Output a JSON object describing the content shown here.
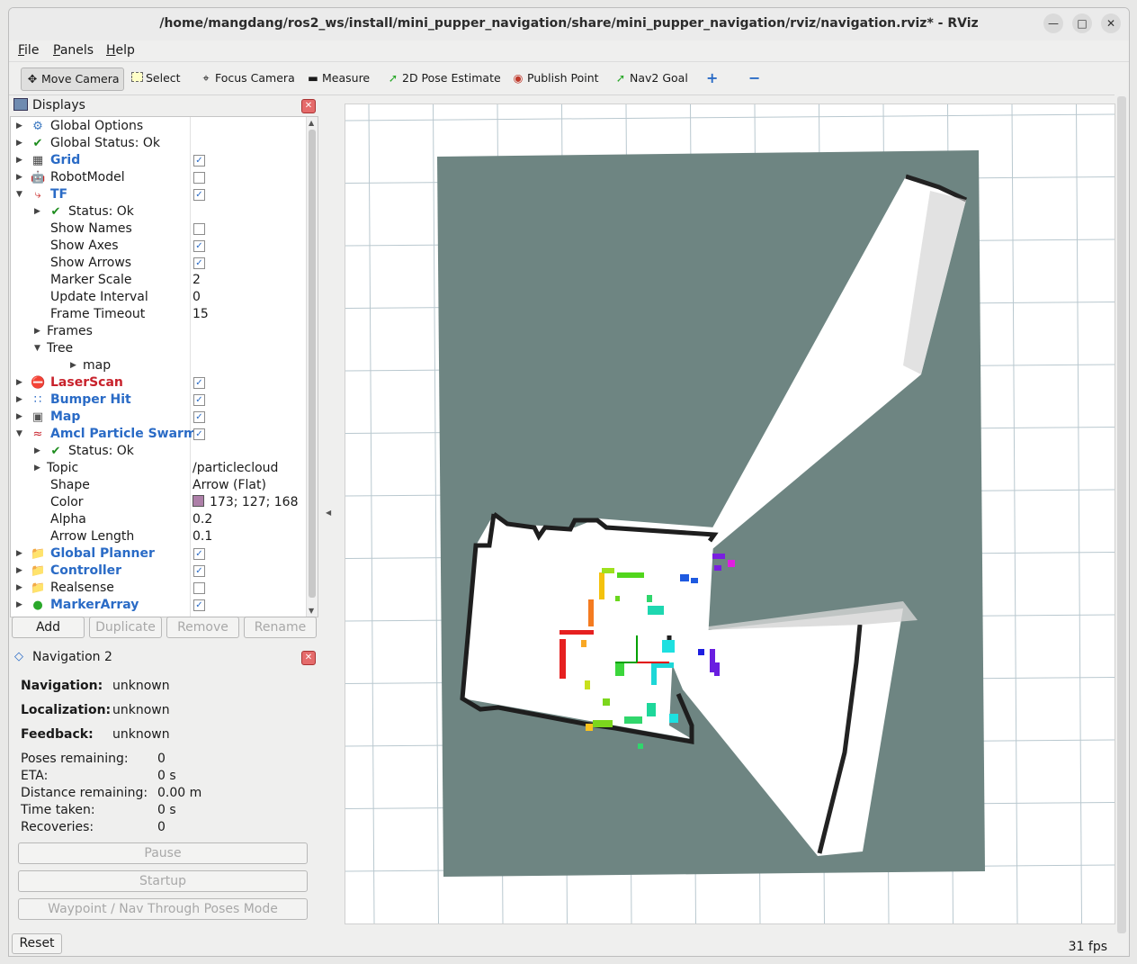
{
  "window": {
    "title": "/home/mangdang/ros2_ws/install/mini_pupper_navigation/share/mini_pupper_navigation/rviz/navigation.rviz* - RViz",
    "controls": [
      "minimize",
      "maximize",
      "close"
    ]
  },
  "menubar": [
    {
      "label": "File",
      "mnemonic": "F",
      "rest": "ile"
    },
    {
      "label": "Panels",
      "mnemonic": "P",
      "rest": "anels"
    },
    {
      "label": "Help",
      "mnemonic": "H",
      "rest": "elp"
    }
  ],
  "toolbar": [
    {
      "label": "Move Camera",
      "icon": "move-camera-icon",
      "active": true
    },
    {
      "label": "Select",
      "icon": "select-icon"
    },
    {
      "label": "Focus Camera",
      "icon": "focus-camera-icon"
    },
    {
      "label": "Measure",
      "icon": "measure-icon"
    },
    {
      "label": "2D Pose Estimate",
      "icon": "pose-estimate-icon"
    },
    {
      "label": "Publish Point",
      "icon": "publish-point-icon"
    },
    {
      "label": "Nav2 Goal",
      "icon": "nav2-goal-icon"
    },
    {
      "label": "",
      "icon": "plus-icon"
    },
    {
      "label": "",
      "icon": "minus-icon"
    }
  ],
  "displays": {
    "title": "Displays",
    "rows": [
      {
        "label": "Global Options",
        "style": "normal",
        "icon": "gear-icon",
        "arrow": "right",
        "indent": 0
      },
      {
        "label": "Global Status: Ok",
        "style": "normal",
        "icon": "check-icon",
        "arrow": "right",
        "indent": 0
      },
      {
        "label": "Grid",
        "style": "hl",
        "icon": "grid-icon",
        "arrow": "right",
        "indent": 0,
        "checked": true
      },
      {
        "label": "RobotModel",
        "style": "normal",
        "icon": "robot-icon",
        "arrow": "right",
        "indent": 0,
        "checked": false
      },
      {
        "label": "TF",
        "style": "hl",
        "icon": "tf-icon",
        "arrow": "down",
        "indent": 0,
        "checked": true
      },
      {
        "label": "Status: Ok",
        "style": "normal",
        "icon": "check-icon",
        "arrow": "right",
        "indent": 1
      },
      {
        "label": "Show Names",
        "style": "normal",
        "indent": 2,
        "checked": false
      },
      {
        "label": "Show Axes",
        "style": "normal",
        "indent": 2,
        "checked": true
      },
      {
        "label": "Show Arrows",
        "style": "normal",
        "indent": 2,
        "checked": true
      },
      {
        "label": "Marker Scale",
        "style": "normal",
        "indent": 2,
        "value": "2"
      },
      {
        "label": "Update Interval",
        "style": "normal",
        "indent": 2,
        "value": "0"
      },
      {
        "label": "Frame Timeout",
        "style": "normal",
        "indent": 2,
        "value": "15"
      },
      {
        "label": "Frames",
        "style": "normal",
        "arrow": "right",
        "indent": 1,
        "noicon": true
      },
      {
        "label": "Tree",
        "style": "normal",
        "arrow": "down",
        "indent": 1,
        "noicon": true
      },
      {
        "label": "map",
        "style": "normal",
        "arrow": "right",
        "indent": 3,
        "noicon": true
      },
      {
        "label": "LaserScan",
        "style": "err",
        "icon": "error-icon",
        "arrow": "right",
        "indent": 0,
        "checked": true
      },
      {
        "label": "Bumper Hit",
        "style": "hl",
        "icon": "points-icon",
        "arrow": "right",
        "indent": 0,
        "checked": true
      },
      {
        "label": "Map",
        "style": "hl",
        "icon": "map-icon",
        "arrow": "right",
        "indent": 0,
        "checked": true
      },
      {
        "label": "Amcl Particle Swarm",
        "style": "hl",
        "icon": "particle-icon",
        "arrow": "down",
        "indent": 0,
        "checked": true
      },
      {
        "label": "Status: Ok",
        "style": "normal",
        "icon": "check-icon",
        "arrow": "right",
        "indent": 1
      },
      {
        "label": "Topic",
        "style": "normal",
        "arrow": "right",
        "indent": 1,
        "noicon": true,
        "value": "/particlecloud"
      },
      {
        "label": "Shape",
        "style": "normal",
        "indent": 2,
        "value": "Arrow (Flat)"
      },
      {
        "label": "Color",
        "style": "normal",
        "indent": 2,
        "value": "173; 127; 168",
        "swatch": "#ad7fa8"
      },
      {
        "label": "Alpha",
        "style": "normal",
        "indent": 2,
        "value": "0.2"
      },
      {
        "label": "Arrow Length",
        "style": "normal",
        "indent": 2,
        "value": "0.1"
      },
      {
        "label": "Global Planner",
        "style": "hl",
        "icon": "folder-icon",
        "arrow": "right",
        "indent": 0,
        "checked": true
      },
      {
        "label": "Controller",
        "style": "hl",
        "icon": "folder-icon",
        "arrow": "right",
        "indent": 0,
        "checked": true
      },
      {
        "label": "Realsense",
        "style": "normal",
        "icon": "folder-icon",
        "arrow": "right",
        "indent": 0,
        "checked": false
      },
      {
        "label": "MarkerArray",
        "style": "hl",
        "icon": "marker-icon",
        "arrow": "right",
        "indent": 0,
        "checked": true
      }
    ],
    "buttons": [
      {
        "label": "Add",
        "enabled": true
      },
      {
        "label": "Duplicate",
        "enabled": false
      },
      {
        "label": "Remove",
        "enabled": false
      },
      {
        "label": "Rename",
        "enabled": false
      }
    ]
  },
  "navigation": {
    "title": "Navigation 2",
    "status": [
      {
        "label": "Navigation:",
        "value": "unknown"
      },
      {
        "label": "Localization:",
        "value": "unknown"
      },
      {
        "label": "Feedback:",
        "value": "unknown"
      }
    ],
    "metrics": [
      {
        "label": "Poses remaining:",
        "value": "0"
      },
      {
        "label": "ETA:",
        "value": "0 s"
      },
      {
        "label": "Distance remaining:",
        "value": "0.00 m"
      },
      {
        "label": "Time taken:",
        "value": "0 s"
      },
      {
        "label": "Recoveries:",
        "value": "0"
      }
    ],
    "buttons": [
      "Pause",
      "Startup",
      "Waypoint / Nav Through Poses Mode"
    ]
  },
  "footer": {
    "reset": "Reset",
    "fps": "31 fps"
  },
  "colors": {
    "map_bg": "#6e8582",
    "grid": "#b9c8cf",
    "tree_highlight": "#2a6bc6",
    "error": "#c8222c"
  }
}
